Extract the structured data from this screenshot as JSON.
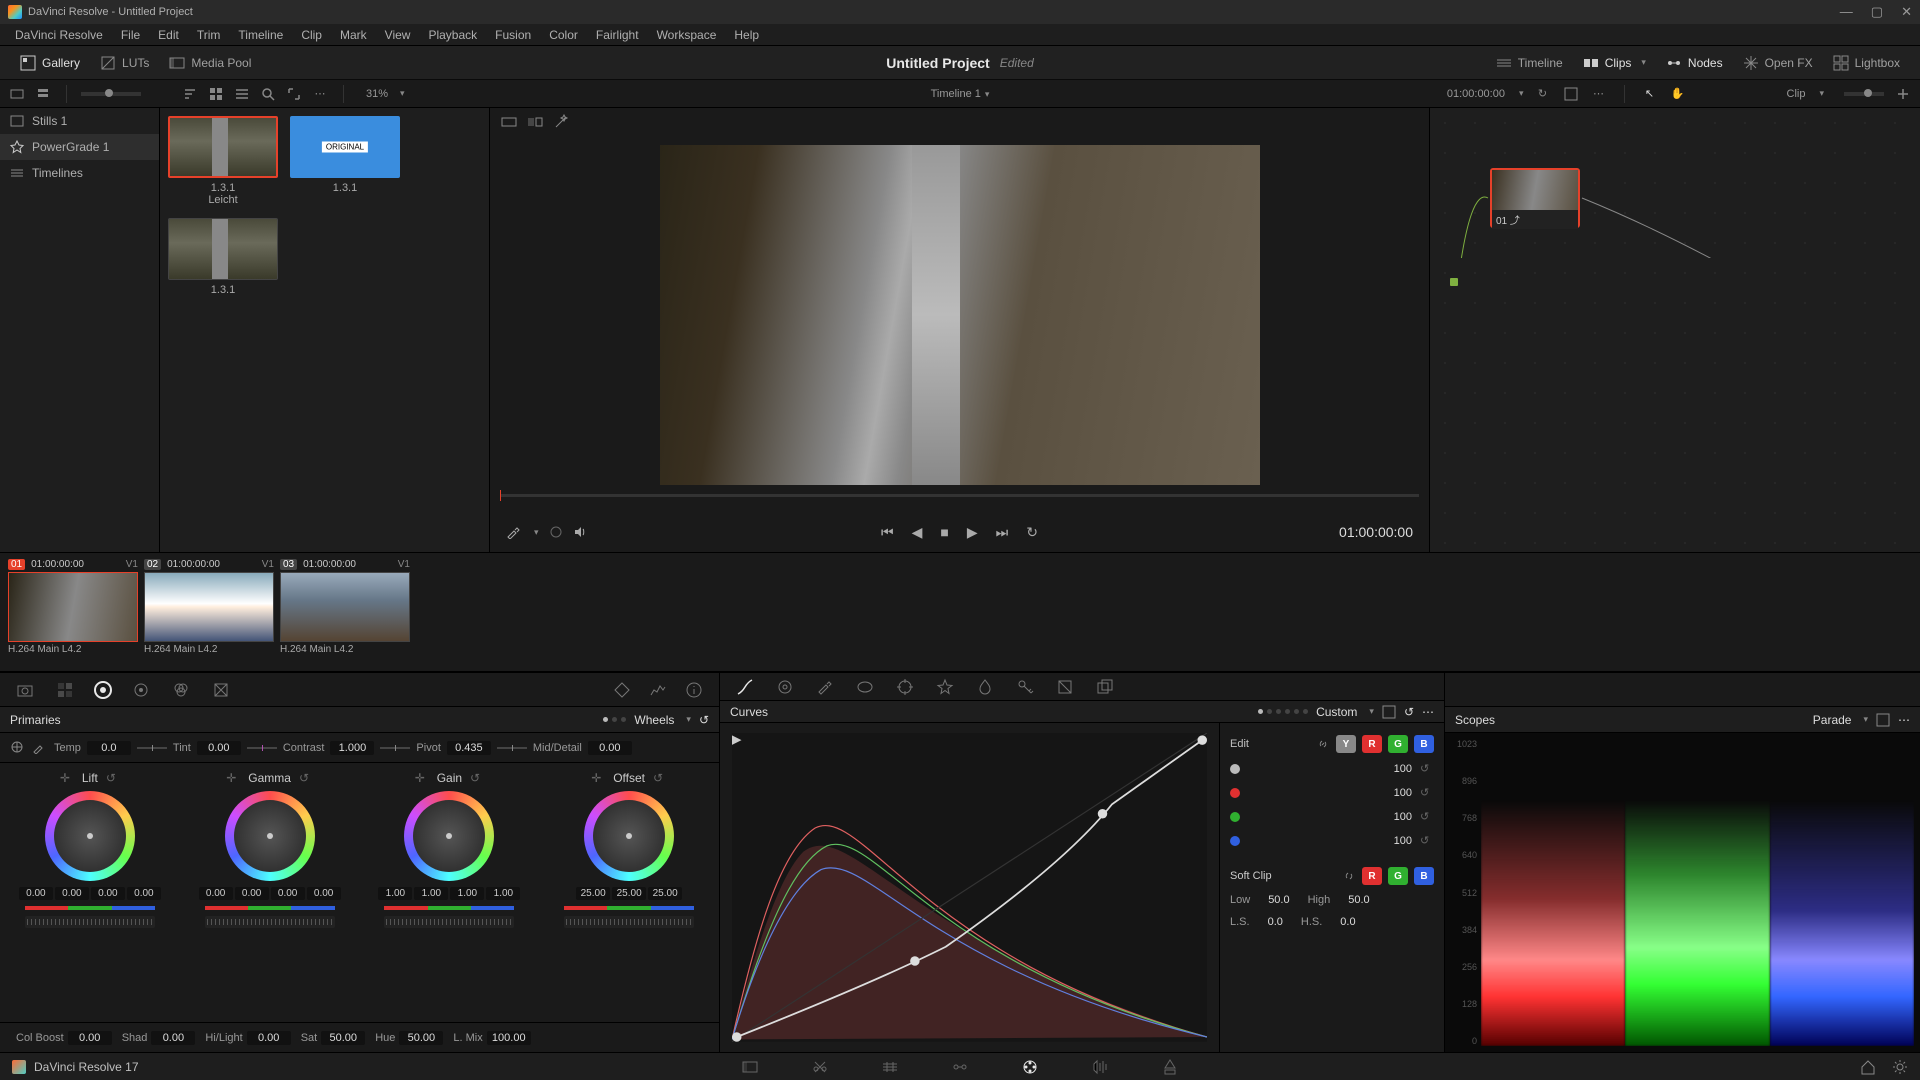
{
  "app": {
    "title": "DaVinci Resolve - Untitled Project"
  },
  "menu": [
    "DaVinci Resolve",
    "File",
    "Edit",
    "Trim",
    "Timeline",
    "Clip",
    "Mark",
    "View",
    "Playback",
    "Fusion",
    "Color",
    "Fairlight",
    "Workspace",
    "Help"
  ],
  "project": {
    "name": "Untitled Project",
    "status": "Edited"
  },
  "toptabs": {
    "gallery": "Gallery",
    "luts": "LUTs",
    "mediapool": "Media Pool",
    "timeline": "Timeline",
    "clips": "Clips",
    "nodes": "Nodes",
    "openfx": "Open FX",
    "lightbox": "Lightbox"
  },
  "secbar": {
    "zoom": "31%",
    "timeline_name": "Timeline 1",
    "timecode": "01:00:00:00",
    "clip_dropdown": "Clip"
  },
  "leftbar": {
    "items": [
      {
        "label": "Stills 1"
      },
      {
        "label": "PowerGrade 1"
      },
      {
        "label": "Timelines"
      }
    ]
  },
  "gallery": {
    "thumbs": [
      {
        "version": "1.3.1",
        "name": "Leicht"
      },
      {
        "version": "1.3.1",
        "tag": "ORIGINAL"
      },
      {
        "version": "1.3.1"
      }
    ]
  },
  "nodes": {
    "node1_label": "01"
  },
  "transport": {
    "timecode": "01:00:00:00"
  },
  "clips": [
    {
      "num": "01",
      "tc": "01:00:00:00",
      "track": "V1",
      "codec": "H.264 Main L4.2"
    },
    {
      "num": "02",
      "tc": "01:00:00:00",
      "track": "V1",
      "codec": "H.264 Main L4.2"
    },
    {
      "num": "03",
      "tc": "01:00:00:00",
      "track": "V1",
      "codec": "H.264 Main L4.2"
    }
  ],
  "primaries": {
    "title": "Primaries",
    "mode": "Wheels",
    "params": {
      "temp_label": "Temp",
      "temp": "0.0",
      "tint_label": "Tint",
      "tint": "0.00",
      "contrast_label": "Contrast",
      "contrast": "1.000",
      "pivot_label": "Pivot",
      "pivot": "0.435",
      "md_label": "Mid/Detail",
      "md": "0.00"
    },
    "wheels": {
      "lift": {
        "title": "Lift",
        "vals": [
          "0.00",
          "0.00",
          "0.00",
          "0.00"
        ]
      },
      "gamma": {
        "title": "Gamma",
        "vals": [
          "0.00",
          "0.00",
          "0.00",
          "0.00"
        ]
      },
      "gain": {
        "title": "Gain",
        "vals": [
          "1.00",
          "1.00",
          "1.00",
          "1.00"
        ]
      },
      "offset": {
        "title": "Offset",
        "vals": [
          "25.00",
          "25.00",
          "25.00"
        ]
      }
    },
    "bottom": {
      "colboost_label": "Col Boost",
      "colboost": "0.00",
      "shad_label": "Shad",
      "shad": "0.00",
      "hilight_label": "Hi/Light",
      "hilight": "0.00",
      "sat_label": "Sat",
      "sat": "50.00",
      "hue_label": "Hue",
      "hue": "50.00",
      "lmix_label": "L. Mix",
      "lmix": "100.00"
    }
  },
  "curves": {
    "title": "Curves",
    "mode": "Custom",
    "edit": {
      "title": "Edit",
      "channels": [
        {
          "color": "#bbbbbb",
          "val": "100"
        },
        {
          "color": "#e03030",
          "val": "100"
        },
        {
          "color": "#30b030",
          "val": "100"
        },
        {
          "color": "#3060e0",
          "val": "100"
        }
      ],
      "soft_title": "Soft Clip",
      "low_label": "Low",
      "low": "50.0",
      "high_label": "High",
      "high": "50.0",
      "ls_label": "L.S.",
      "ls": "0.0",
      "hs_label": "H.S.",
      "hs": "0.0"
    }
  },
  "scopes": {
    "title": "Scopes",
    "mode": "Parade",
    "yticks": [
      "1023",
      "896",
      "768",
      "640",
      "512",
      "384",
      "256",
      "128",
      "0"
    ]
  },
  "footer": {
    "version": "DaVinci Resolve 17"
  }
}
